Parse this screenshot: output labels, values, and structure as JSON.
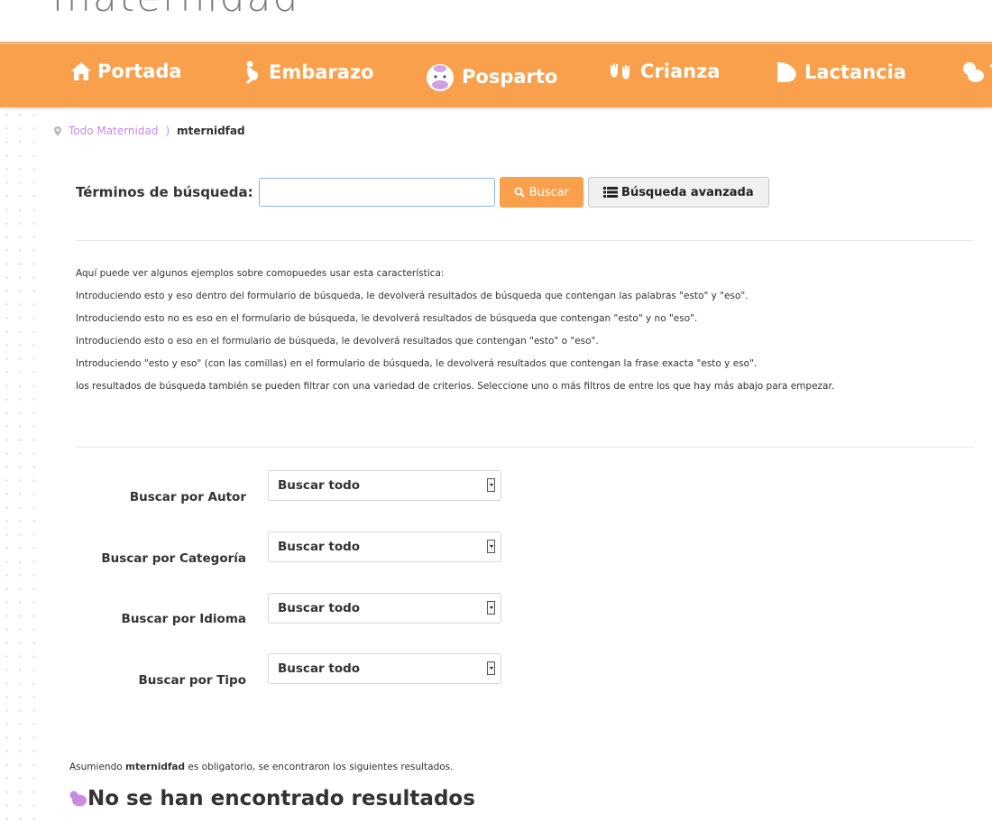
{
  "site": {
    "logo_text": "maternidad"
  },
  "nav": {
    "items": [
      {
        "label": "Portada",
        "icon": "house-icon"
      },
      {
        "label": "Embarazo",
        "icon": "pregnant-icon"
      },
      {
        "label": "Posparto",
        "icon": "baby-face-icon"
      },
      {
        "label": "Crianza",
        "icon": "hands-icon"
      },
      {
        "label": "Lactancia",
        "icon": "breast-icon"
      },
      {
        "label": "T",
        "icon": "pacifier-icon"
      }
    ]
  },
  "breadcrumb": {
    "home": "Todo Maternidad",
    "separator": ")",
    "current": "mternidfad"
  },
  "search": {
    "label": "Términos de búsqueda:",
    "value": "",
    "button_label": "Buscar",
    "advanced_label": "Búsqueda avanzada"
  },
  "examples": {
    "lines": [
      "Aquí puede ver algunos ejemplos sobre comopuedes usar esta característica:",
      "Introduciendo esto y eso dentro del formulario de búsqueda, le devolverá resultados de búsqueda que contengan las palabras \"esto\" y \"eso\".",
      "Introduciendo esto no es eso en el formulario de búsqueda, le devolverá resultados de búsqueda que contengan \"esto\" y no \"eso\".",
      "Introduciendo esto o eso en el formulario de búsqueda, le devolverá resultados que contengan \"esto\" o \"eso\".",
      "Introduciendo \"esto y eso\" (con las comillas) en el formulario de búsqueda, le devolverá resultados que contengan la frase exacta \"esto y eso\".",
      "los resultados de búsqueda también se pueden filtrar con una variedad de criterios. Seleccione uno o más filtros de entre los que hay más abajo para empezar."
    ]
  },
  "filters": [
    {
      "label": "Buscar por Autor",
      "value": "Buscar todo"
    },
    {
      "label": "Buscar por Categoría",
      "value": "Buscar todo"
    },
    {
      "label": "Buscar por Idioma",
      "value": "Buscar todo"
    },
    {
      "label": "Buscar por Tipo",
      "value": "Buscar todo"
    }
  ],
  "results": {
    "assume_prefix": "Asumiendo",
    "assume_term": "mternidfad",
    "assume_suffix": "es obligatorio, se encontraron los siguientes resultados.",
    "no_results": "No se han encontrado resultados"
  },
  "colors": {
    "accent": "#f9a04c",
    "link": "#c58ae6",
    "icon_purple": "#c98ae0"
  }
}
